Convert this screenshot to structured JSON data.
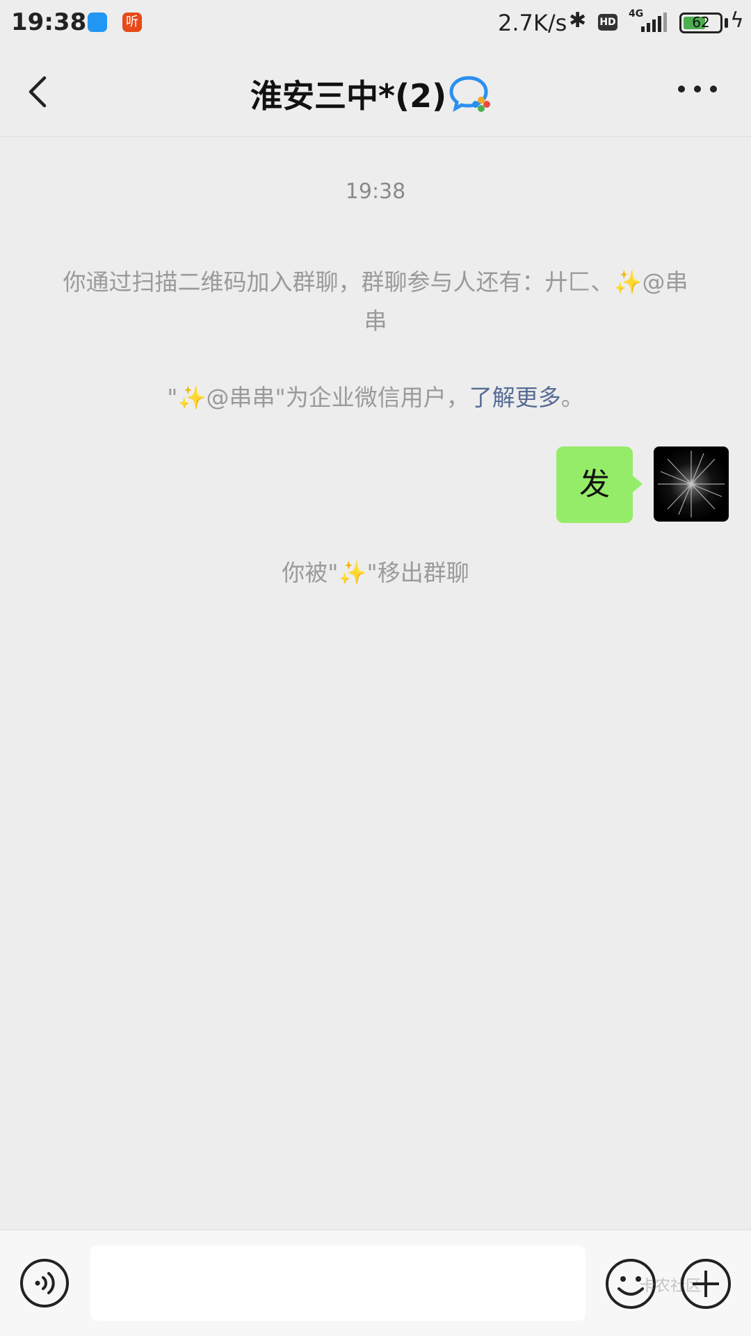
{
  "status_bar": {
    "time": "19:38",
    "app2_label": "听",
    "net_speed": "2.7K/s",
    "bluetooth_glyph": "✱",
    "hd_label": "HD",
    "network_type": "4G",
    "battery": "62",
    "battery_level": 0.62,
    "charging_glyph": "ϟ"
  },
  "nav": {
    "title": "淮安三中*(2)",
    "more_glyph": "more-dots-icon"
  },
  "chat": {
    "timestamp": "19:38",
    "join_notice": "你通过扫描二维码加入群聊，群聊参与人还有：廾匚、✨@串串",
    "wecom_notice_prefix": "\"✨@串串\"为企业微信用户，",
    "wecom_notice_link": "了解更多",
    "wecom_notice_suffix": "。",
    "my_message": "发",
    "removed_notice": "你被\"✨\"移出群聊"
  },
  "input_bar": {
    "input_value": "",
    "watermark": "卡农社区"
  },
  "colors": {
    "background": "#ededed",
    "bubble_green": "#95ec69",
    "link_blue": "#576b95",
    "system_text": "#9a9a9a"
  }
}
